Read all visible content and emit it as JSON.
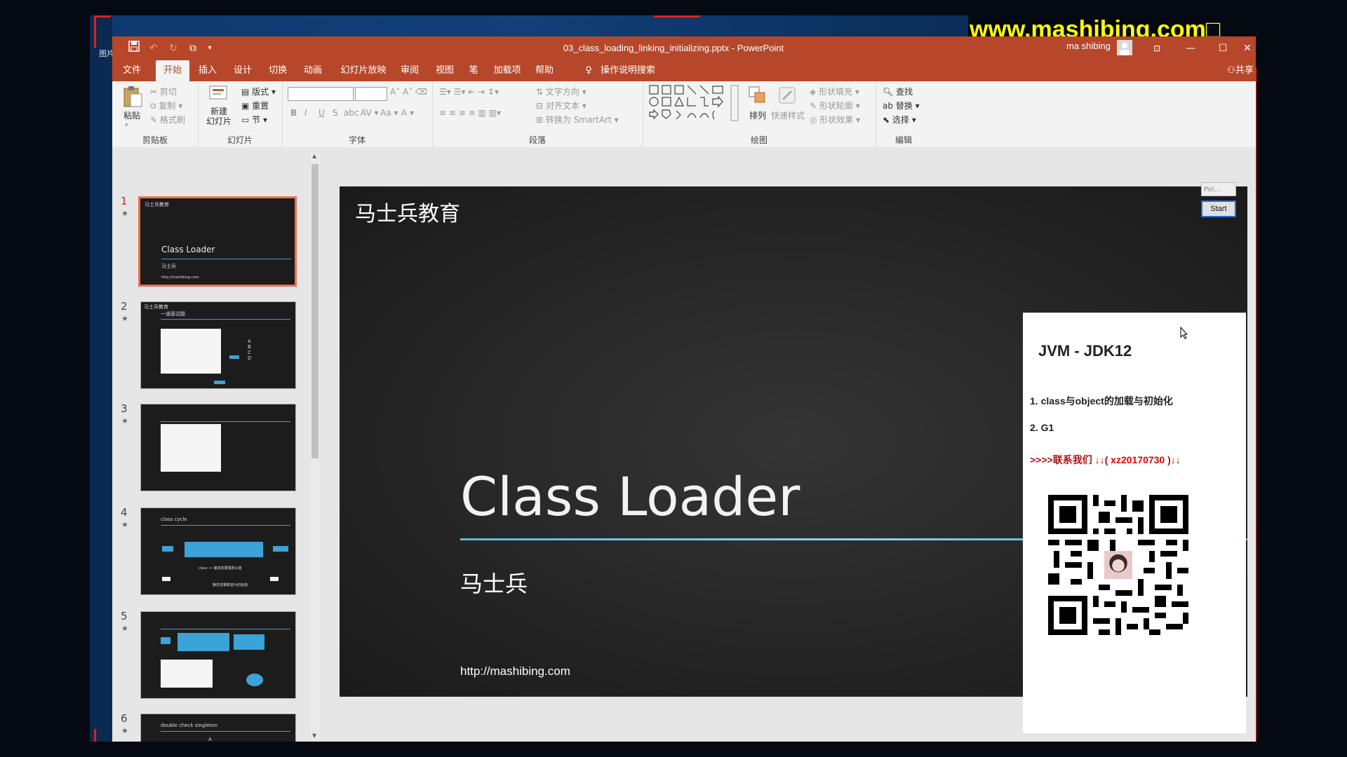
{
  "watermark": "www.mashibing.com□",
  "side_fragment": "图片",
  "window": {
    "title": "03_class_loading_linking_initializing.pptx  -  PowerPoint",
    "user": "ma shibing",
    "share": "共享"
  },
  "tabs": [
    "文件",
    "开始",
    "插入",
    "设计",
    "切换",
    "动画",
    "幻灯片放映",
    "审阅",
    "视图",
    "笔",
    "加载项",
    "帮助",
    "操作说明搜索"
  ],
  "ribbon": {
    "clipboard": {
      "label": "剪贴板",
      "paste": "粘贴",
      "cut": "剪切",
      "copy": "复制",
      "format_painter": "格式刷"
    },
    "slides": {
      "label": "幻灯片",
      "new_slide": "新建\n幻灯片",
      "layout": "版式",
      "reset": "重置",
      "section": "节"
    },
    "font": {
      "label": "字体"
    },
    "paragraph": {
      "label": "段落",
      "text_direction": "文字方向",
      "align_text": "对齐文本",
      "smartart": "转换为 SmartArt"
    },
    "drawing": {
      "label": "绘图",
      "arrange": "排列",
      "quick_styles": "快速样式",
      "shape_fill": "形状填充",
      "shape_outline": "形状轮廓",
      "shape_effects": "形状效果"
    },
    "editing": {
      "label": "编辑",
      "find": "查找",
      "replace": "替换",
      "select": "选择"
    }
  },
  "thumbnails": [
    {
      "num": "1",
      "title": "Class Loader",
      "sub": "马士兵",
      "brand": "马士兵教育",
      "url": "http://mashibing.com"
    },
    {
      "num": "2",
      "title": "一道面试题",
      "brand": "马士兵教育",
      "opts": "A B C D"
    },
    {
      "num": "3"
    },
    {
      "num": "4",
      "title": "class cycle",
      "note1": "class -> 静态变量赋默认值",
      "note2": "静态变量赋值为初始值"
    },
    {
      "num": "5"
    },
    {
      "num": "6",
      "title": "double check singleton",
      "mark": "A"
    }
  ],
  "slide": {
    "brand": "马士兵教育",
    "title": "Class Loader",
    "author": "马士兵",
    "url": "http://mashibing.com"
  },
  "panel": {
    "title": "JVM - JDK12",
    "item1": "1. class与object的加载与初始化",
    "item2": "2. G1",
    "contact_prefix": ">>>>联系我们 ↓↓( ",
    "contact_id": "xz20170730",
    "contact_suffix": " )↓↓"
  },
  "pointer_tool": {
    "placeholder": "Poi...",
    "start": "Start"
  }
}
